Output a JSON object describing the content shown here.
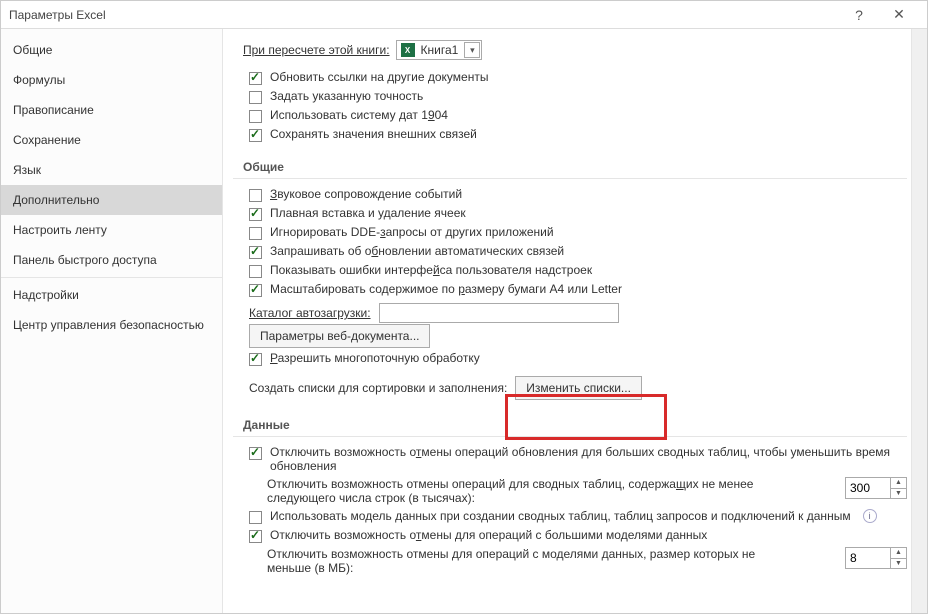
{
  "window": {
    "title": "Параметры Excel"
  },
  "sidebar": {
    "items": [
      {
        "label": "Общие"
      },
      {
        "label": "Формулы"
      },
      {
        "label": "Правописание"
      },
      {
        "label": "Сохранение"
      },
      {
        "label": "Язык"
      },
      {
        "label": "Дополнительно"
      },
      {
        "label": "Настроить ленту"
      },
      {
        "label": "Панель быстрого доступа"
      },
      {
        "label": "Надстройки"
      },
      {
        "label": "Центр управления безопасностью"
      }
    ],
    "selected": 5
  },
  "main": {
    "recalc": {
      "label": "При пересчете этой книги:",
      "book": "Книга1"
    },
    "recalc_opts": [
      {
        "checked": true,
        "label": "Обновить ссылки на другие документы"
      },
      {
        "checked": false,
        "label": "Задать указанную точность"
      },
      {
        "checked": false,
        "label": "Использовать систему дат 1904",
        "u": "9"
      },
      {
        "checked": true,
        "label": "Сохранять значения внешних связей"
      }
    ],
    "general_head": "Общие",
    "general_opts": [
      {
        "checked": false,
        "label": "Звуковое сопровождение событий",
        "u": "З"
      },
      {
        "checked": true,
        "label": "Плавная вставка и удаление ячеек"
      },
      {
        "checked": false,
        "label": "Игнорировать DDE-запросы от других приложений",
        "u": "з"
      },
      {
        "checked": true,
        "label": "Запрашивать об обновлении автоматических связей",
        "u": "б"
      },
      {
        "checked": false,
        "label": "Показывать ошибки интерфейса пользователя надстроек",
        "u": "й"
      },
      {
        "checked": true,
        "label": "Масштабировать содержимое по размеру бумаги А4 или Letter",
        "u": "р"
      }
    ],
    "autostart": {
      "label": "Каталог автозагрузки:",
      "value": ""
    },
    "web_btn": "Параметры веб-документа...",
    "multithread": {
      "checked": true,
      "label": "Разрешить многопоточную обработку",
      "u": "Р"
    },
    "customlists": {
      "label": "Создать списки для сортировки и заполнения:",
      "btn": "Изменить списки..."
    },
    "data_head": "Данные",
    "data_opts": {
      "a": {
        "checked": true,
        "label": "Отключить возможность отмены операций обновления для больших сводных таблиц, чтобы уменьшить время обновления",
        "u": "т"
      },
      "b": {
        "label": "Отключить возможность отмены операций для сводных таблиц, содержащих не менее следующего числа строк (в тысячах):",
        "u": "щ",
        "value": "300"
      },
      "c": {
        "checked": false,
        "label": "Использовать модель данных при создании сводных таблиц, таблиц запросов и подключений к данным"
      },
      "d": {
        "checked": true,
        "label": "Отключить возможность отмены для операций с большими моделями данных",
        "u": "т"
      },
      "e": {
        "label": "Отключить возможность отмены для операций с моделями данных, размер которых не меньше (в МБ):",
        "value": "8"
      }
    }
  }
}
